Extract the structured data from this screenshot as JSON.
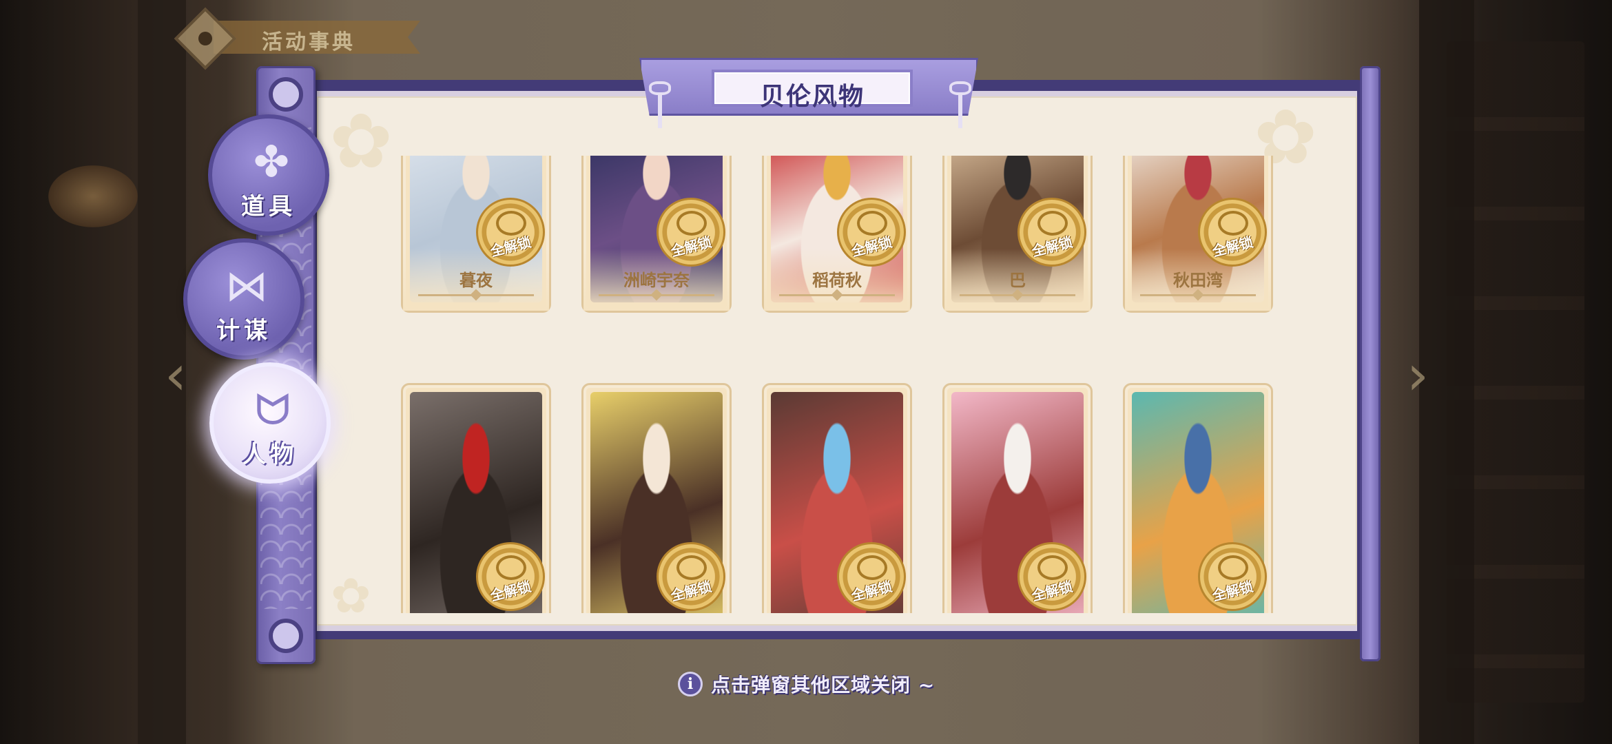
{
  "event_book": {
    "title": "活动事典"
  },
  "panel": {
    "title": "贝伦风物"
  },
  "tabs": [
    {
      "label": "道具",
      "icon": "puzzle-icon",
      "active": false
    },
    {
      "label": "计谋",
      "icon": "bow-icon",
      "active": false
    },
    {
      "label": "人物",
      "icon": "cat-head-icon",
      "active": true
    }
  ],
  "cards_row1": [
    {
      "name": "暮夜",
      "badge": "全解锁",
      "art_colors": [
        "#dfe6ee",
        "#b8c6d6",
        "#f1e2d2"
      ]
    },
    {
      "name": "洲崎宇奈",
      "badge": "全解锁",
      "art_colors": [
        "#2b2f5c",
        "#6c4f86",
        "#f2d6c6"
      ]
    },
    {
      "name": "稻荷秋",
      "badge": "全解锁",
      "art_colors": [
        "#c6282a",
        "#f4e8e0",
        "#e7b04a"
      ]
    },
    {
      "name": "巴",
      "badge": "全解锁",
      "art_colors": [
        "#e0c4a2",
        "#6d4c35",
        "#2d2a2a"
      ]
    },
    {
      "name": "秋田湾",
      "badge": "全解锁",
      "art_colors": [
        "#f2ede8",
        "#b97a4c",
        "#b83b44"
      ]
    }
  ],
  "cards_row2": [
    {
      "badge": "全解锁",
      "art_colors": [
        "#7a6f6a",
        "#2e2622",
        "#c02422"
      ]
    },
    {
      "badge": "全解锁",
      "art_colors": [
        "#e8cf6a",
        "#4a3026",
        "#f4e6d6"
      ]
    },
    {
      "badge": "全解锁",
      "art_colors": [
        "#5a3a34",
        "#c94f48",
        "#7ac0e8"
      ]
    },
    {
      "badge": "全解锁",
      "art_colors": [
        "#f2b8c8",
        "#9c3c3a",
        "#f4f0ec"
      ]
    },
    {
      "badge": "全解锁",
      "art_colors": [
        "#5bb8b0",
        "#e8a248",
        "#4870a8"
      ]
    }
  ],
  "hint": {
    "text": "点击弹窗其他区域关闭 ~"
  },
  "colors": {
    "accent": "#7a6db4",
    "paper": "#f3ece0",
    "gold": "#c99a3e"
  }
}
